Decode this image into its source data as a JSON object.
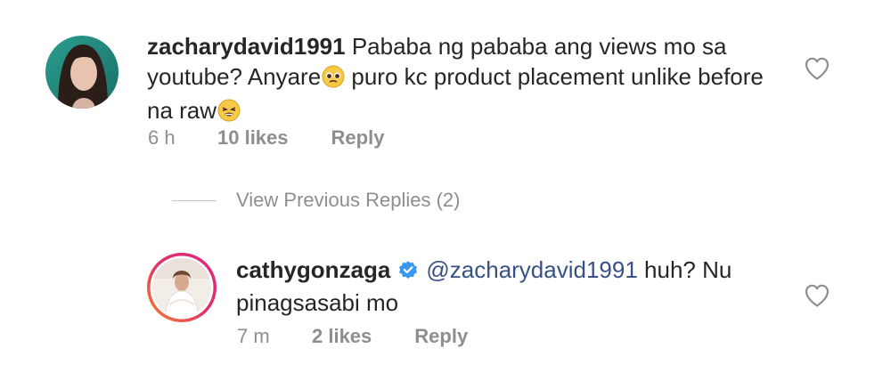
{
  "comment": {
    "username": "zacharydavid1991",
    "text_part1": "Pababa ng pababa ang views mo sa youtube? Anyare",
    "emoji1": "pleading-face-emoji",
    "text_part2": " puro kc product placement unlike before na raw",
    "emoji2": "tired-face-emoji",
    "time": "6 h",
    "likes": "10 likes",
    "reply_label": "Reply"
  },
  "view_previous": {
    "label": "View Previous Replies (2)"
  },
  "reply": {
    "username": "cathygonzaga",
    "verified": true,
    "mention": "@zacharydavid1991",
    "text": " huh? Nu pinagsasabi mo",
    "time": "7 m",
    "likes": "2 likes",
    "reply_label": "Reply"
  },
  "colors": {
    "text": "#262626",
    "meta": "#8e8e8e",
    "mention": "#385185",
    "verified": "#3897f0",
    "story_ring_start": "#f58529",
    "story_ring_end": "#dd2a7b"
  },
  "icons": {
    "like": "heart-outline-icon",
    "verified": "verified-badge-icon"
  }
}
